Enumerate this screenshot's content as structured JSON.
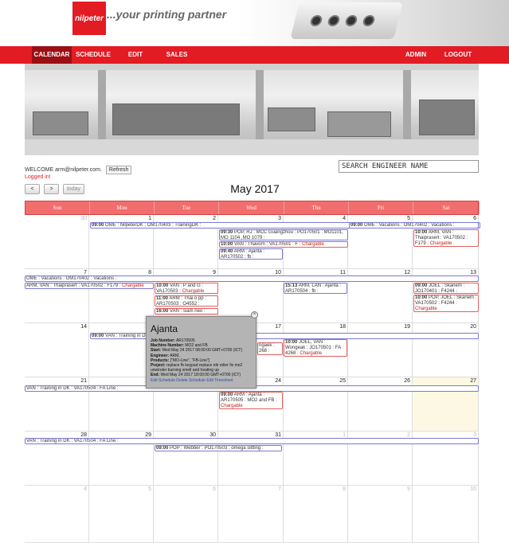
{
  "header": {
    "logo_text": "nilpeter",
    "tagline": "...your printing partner"
  },
  "nav": {
    "calendar": "CALENDAR",
    "schedule": "SCHEDULE",
    "edit": "EDIT",
    "sales": "SALES",
    "admin": "ADMIN",
    "logout": "LOGOUT"
  },
  "welcome": {
    "text": "WELCOME arm@nilpeter.com.",
    "refresh_label": "Refresh",
    "logged_in": "Logged in!"
  },
  "search": {
    "placeholder": "SEARCH ENGINEER NAME"
  },
  "calendar": {
    "prev_label": "<",
    "next_label": ">",
    "today_label": "today",
    "title": "May 2017",
    "day_headers": [
      "Sun",
      "Mon",
      "Tue",
      "Wed",
      "Thu",
      "Fri",
      "Sat"
    ],
    "weeks": [
      [
        "30",
        "1",
        "2",
        "3",
        "4",
        "5",
        "6"
      ],
      [
        "7",
        "8",
        "9",
        "10",
        "11",
        "12",
        "13"
      ],
      [
        "14",
        "15",
        "16",
        "17",
        "18",
        "19",
        "20"
      ],
      [
        "21",
        "22",
        "23",
        "24",
        "25",
        "26",
        "27"
      ],
      [
        "28",
        "29",
        "30",
        "31",
        "1",
        "2",
        "3"
      ],
      [
        "4",
        "5",
        "6",
        "7",
        "8",
        "9",
        "10"
      ]
    ],
    "events": {
      "w1_a": {
        "time": "09:00",
        "text": "OME : NilpeterDK : OM170403 : TrainingDK :"
      },
      "w1_b": {
        "time": "09:00",
        "text": "OME : Vacations : OM170402 : Vacations :"
      },
      "w1_c": {
        "time": "09:30",
        "text": "POP, RJ : MCC Guangzhou : PO170501 : MO1101, MO 1104 ,MO 1079 :"
      },
      "w1_d": {
        "time": "10:00",
        "text": "VAN : Thavorn : VA170501 : F :",
        "tail": "Chargable"
      },
      "w1_e": {
        "time": "09:40",
        "text": "ARM : Ajanta : AR170502 : fb :"
      },
      "w1_f": {
        "time": "10:00",
        "text": "ARM, VAN : Thaiprasert : VA170502 : F179 :",
        "tail": "Chargable"
      },
      "w2_a": {
        "text": "OME : Vacations : OM170402 : Vacations :"
      },
      "w2_b": {
        "text": "ARM, VAN : Thaiprasert : VA170502 : F179 :",
        "tail": "Chargable"
      },
      "w2_c": {
        "time": "10:00",
        "text": "VAN : P and G : VA170503 :",
        "tail": "Chargable"
      },
      "w2_d": {
        "time": "11:00",
        "text": "ARM : Thai o pp : AR170503 : O4552 :"
      },
      "w2_e": {
        "time": "16:00",
        "text": "VAN : siam neo :"
      },
      "w2_f": {
        "time": "15:13",
        "text": "ARM, LAN : Ajanta : AR170504 : fb :"
      },
      "w2_g": {
        "time": "09:00",
        "text": "JOEL : Skanem : JO170401 : F4244 :",
        "tail": "Chargable"
      },
      "w2_h": {
        "time": "10:00",
        "text": "POP, JOEL : Skanem : VA170502 : F4244 :",
        "tail": "Chargable"
      },
      "w3_a": {
        "time": "09:00",
        "text": "VAN : Training in DK :"
      },
      "w3_b": {
        "text": "ngaek : 268 :"
      },
      "w3_c": {
        "time": "10:00",
        "text": "JOEL, VAN : Wongeak : JO170501 : FA 4268 :",
        "tail": "Chargable"
      },
      "w4_a": {
        "text": "VAN : Training in DK : VA170504 : FA Line :"
      },
      "w4_b": {
        "time": "09:00",
        "text": "ARM : Ajanta : AR170505 : MO2 and FB :",
        "tail": "Chargable"
      },
      "w5_a": {
        "text": "VAN : Training in DK : VA170504 : FA Line :"
      },
      "w5_b": {
        "time": "09:00",
        "text": "POP : Webber : PO170503 : omega slitting :"
      }
    }
  },
  "popup": {
    "close": "×",
    "title": "Ajanta",
    "job_label": "Job Number:",
    "job": "AR170505",
    "machine_label": "Machine Number:",
    "machine": "MO2 and FB",
    "start_label": "Start:",
    "start": "Wed May 24 2017 08:00:00 GMT+0700 (ICT)",
    "engineer_label": "Engineer:",
    "engineer": "ARM,",
    "products_label": "Products:",
    "products": "[\"MO-Line\", \"FB-Line\"]",
    "project_label": "Project:",
    "project": "replace fb keypad replace nib roller fix mo2 unwinder burning smell and heating up",
    "end_label": "End:",
    "end": "Wed May 24 2017 18:00:00 GMT+0700 (ICT)",
    "links": "Edit Schedule Delete Schedule Edit Timesheet"
  }
}
